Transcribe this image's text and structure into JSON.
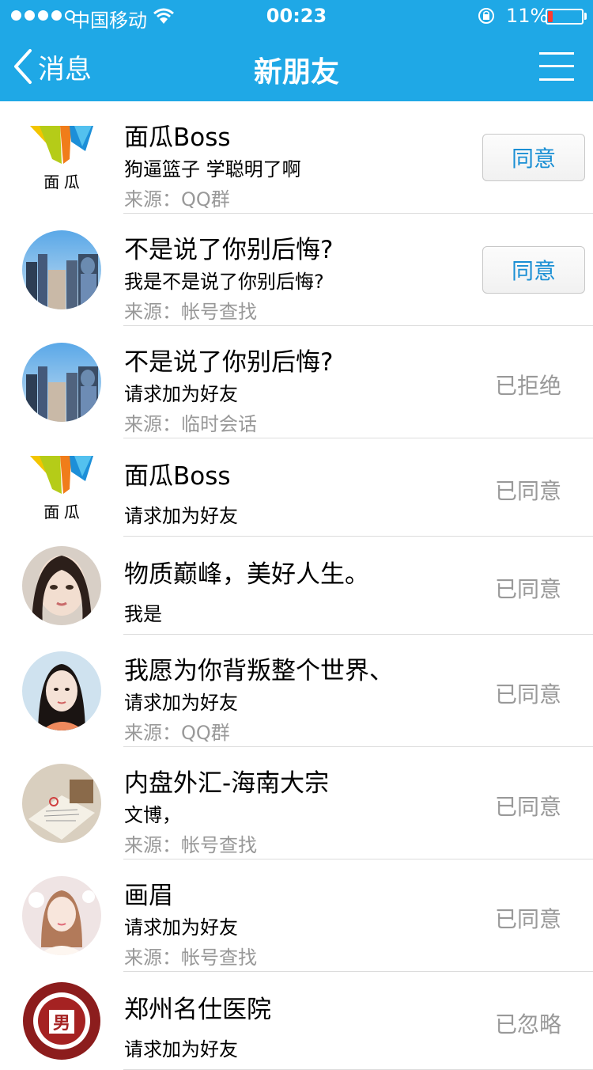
{
  "status_bar": {
    "carrier": "中国移动",
    "time": "00:23",
    "battery": "11%"
  },
  "nav": {
    "back_label": "消息",
    "title": "新朋友"
  },
  "requests": [
    {
      "name": "面瓜Boss",
      "message": "狗逼篮子 学聪明了啊",
      "source": "来源：QQ群",
      "action": "同意",
      "avatar": "logo",
      "logo_text": "面  瓜"
    },
    {
      "name": "不是说了你别后悔?",
      "message": "我是不是说了你别后悔?",
      "source": "来源：帐号查找",
      "action": "同意",
      "avatar": "city"
    },
    {
      "name": "不是说了你别后悔?",
      "message": "请求加为好友",
      "source": "来源：临时会话",
      "status": "已拒绝",
      "avatar": "city"
    },
    {
      "name": "面瓜Boss",
      "message": "请求加为好友",
      "status": "已同意",
      "avatar": "logo",
      "logo_text": "面  瓜"
    },
    {
      "name": "物质巅峰，美好人生。",
      "message": "我是",
      "status": "已同意",
      "avatar": "girl"
    },
    {
      "name": "我愿为你背叛整个世界、",
      "message": "请求加为好友",
      "source": "来源：QQ群",
      "status": "已同意",
      "avatar": "girl2"
    },
    {
      "name": "内盘外汇-海南大宗",
      "message": "文博，",
      "source": "来源：帐号查找",
      "status": "已同意",
      "avatar": "book"
    },
    {
      "name": "画眉",
      "message": "请求加为好友",
      "source": "来源：帐号查找",
      "status": "已同意",
      "avatar": "girl3"
    },
    {
      "name": "郑州名仕医院",
      "message": "请求加为好友",
      "status": "已忽略",
      "avatar": "hospital",
      "logo_text": "男"
    }
  ],
  "colors": {
    "header": "#1fa8e6",
    "accent_button_text": "#1a8fd4",
    "secondary_text": "#999999",
    "battery_low": "#ff3b30"
  }
}
